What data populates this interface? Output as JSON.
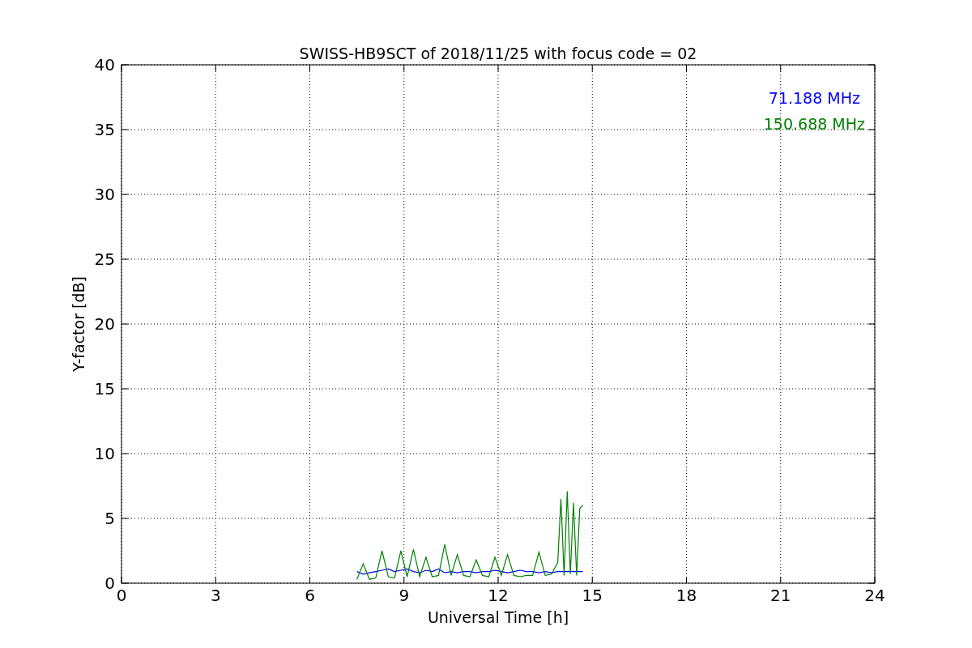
{
  "chart_data": {
    "type": "line",
    "title": "SWISS-HB9SCT of 2018/11/25 with focus code = 02",
    "xlabel": "Universal Time [h]",
    "ylabel": "Y-factor [dB]",
    "x": [
      7.5,
      7.7,
      7.9,
      8.1,
      8.3,
      8.5,
      8.7,
      8.9,
      9.1,
      9.3,
      9.5,
      9.7,
      9.9,
      10.1,
      10.3,
      10.5,
      10.7,
      10.9,
      11.1,
      11.3,
      11.5,
      11.7,
      11.9,
      12.1,
      12.3,
      12.5,
      12.7,
      12.9,
      13.1,
      13.3,
      13.5,
      13.7,
      13.9,
      14.0,
      14.1,
      14.2,
      14.3,
      14.4,
      14.5,
      14.6,
      14.7
    ],
    "series": [
      {
        "name": "71.188 MHz",
        "color": "#0000ff",
        "values": [
          0.9,
          0.7,
          0.8,
          0.9,
          1.0,
          1.1,
          0.9,
          1.0,
          1.1,
          0.9,
          0.8,
          1.0,
          0.9,
          1.1,
          0.8,
          0.9,
          0.8,
          0.9,
          0.9,
          0.8,
          0.9,
          0.9,
          1.0,
          0.9,
          0.8,
          0.9,
          1.0,
          0.9,
          0.9,
          0.8,
          0.9,
          0.8,
          0.9,
          0.9,
          0.9,
          0.9,
          0.9,
          0.9,
          0.9,
          0.9,
          0.9
        ]
      },
      {
        "name": "150.688 MHz",
        "color": "#008000",
        "values": [
          0.3,
          1.5,
          0.3,
          0.4,
          2.5,
          0.5,
          0.4,
          2.5,
          0.5,
          2.6,
          0.5,
          2.0,
          0.5,
          0.6,
          3.0,
          0.6,
          2.2,
          0.6,
          0.5,
          1.8,
          0.6,
          0.5,
          2.0,
          0.6,
          2.2,
          0.6,
          0.5,
          0.6,
          0.6,
          2.4,
          0.6,
          0.7,
          1.6,
          6.5,
          0.6,
          7.1,
          0.7,
          6.2,
          0.6,
          5.8,
          6.0
        ]
      }
    ],
    "grid": true,
    "xlim": [
      0,
      24
    ],
    "ylim": [
      0,
      40
    ],
    "xticks": [
      0,
      3,
      6,
      9,
      12,
      15,
      18,
      21,
      24
    ],
    "yticks": [
      0,
      5,
      10,
      15,
      20,
      25,
      30,
      35,
      40
    ]
  }
}
